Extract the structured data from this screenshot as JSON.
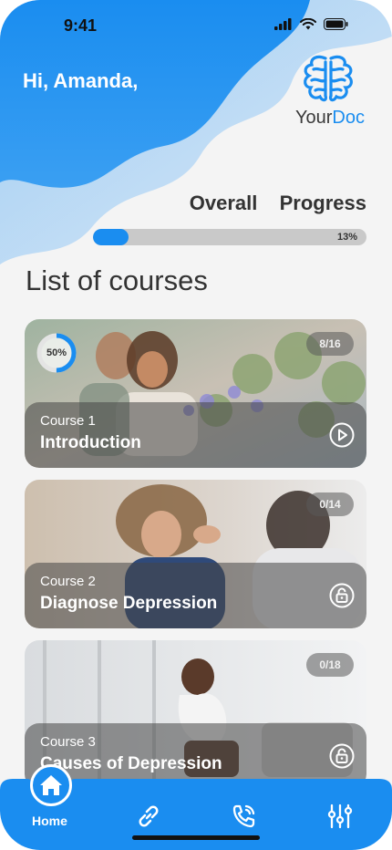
{
  "status_bar": {
    "time": "9:41"
  },
  "header": {
    "greeting": "Hi, Amanda,",
    "logo": {
      "text_main": "Your",
      "text_accent": "Doc"
    }
  },
  "progress": {
    "title": "Overall  Progress",
    "percent_label": "13%",
    "value": 0.13
  },
  "list_title": "List of courses",
  "courses": [
    {
      "number": "Course 1",
      "name": "Introduction",
      "count": "8/16",
      "completion_label": "50%",
      "completion": 0.5,
      "state": "play-icon"
    },
    {
      "number": "Course 2",
      "name": "Diagnose Depression",
      "count": "0/14",
      "state": "lock-icon"
    },
    {
      "number": "Course 3",
      "name": "Causes of Depression",
      "count": "0/18",
      "state": "lock-icon"
    }
  ],
  "nav": {
    "items": [
      {
        "label": "Home",
        "icon": "home-icon",
        "active": true
      },
      {
        "icon": "link-icon"
      },
      {
        "icon": "phone-icon"
      },
      {
        "icon": "sliders-icon"
      }
    ]
  },
  "colors": {
    "accent": "#1a8df0",
    "wave_light": "#6fb6f2"
  }
}
